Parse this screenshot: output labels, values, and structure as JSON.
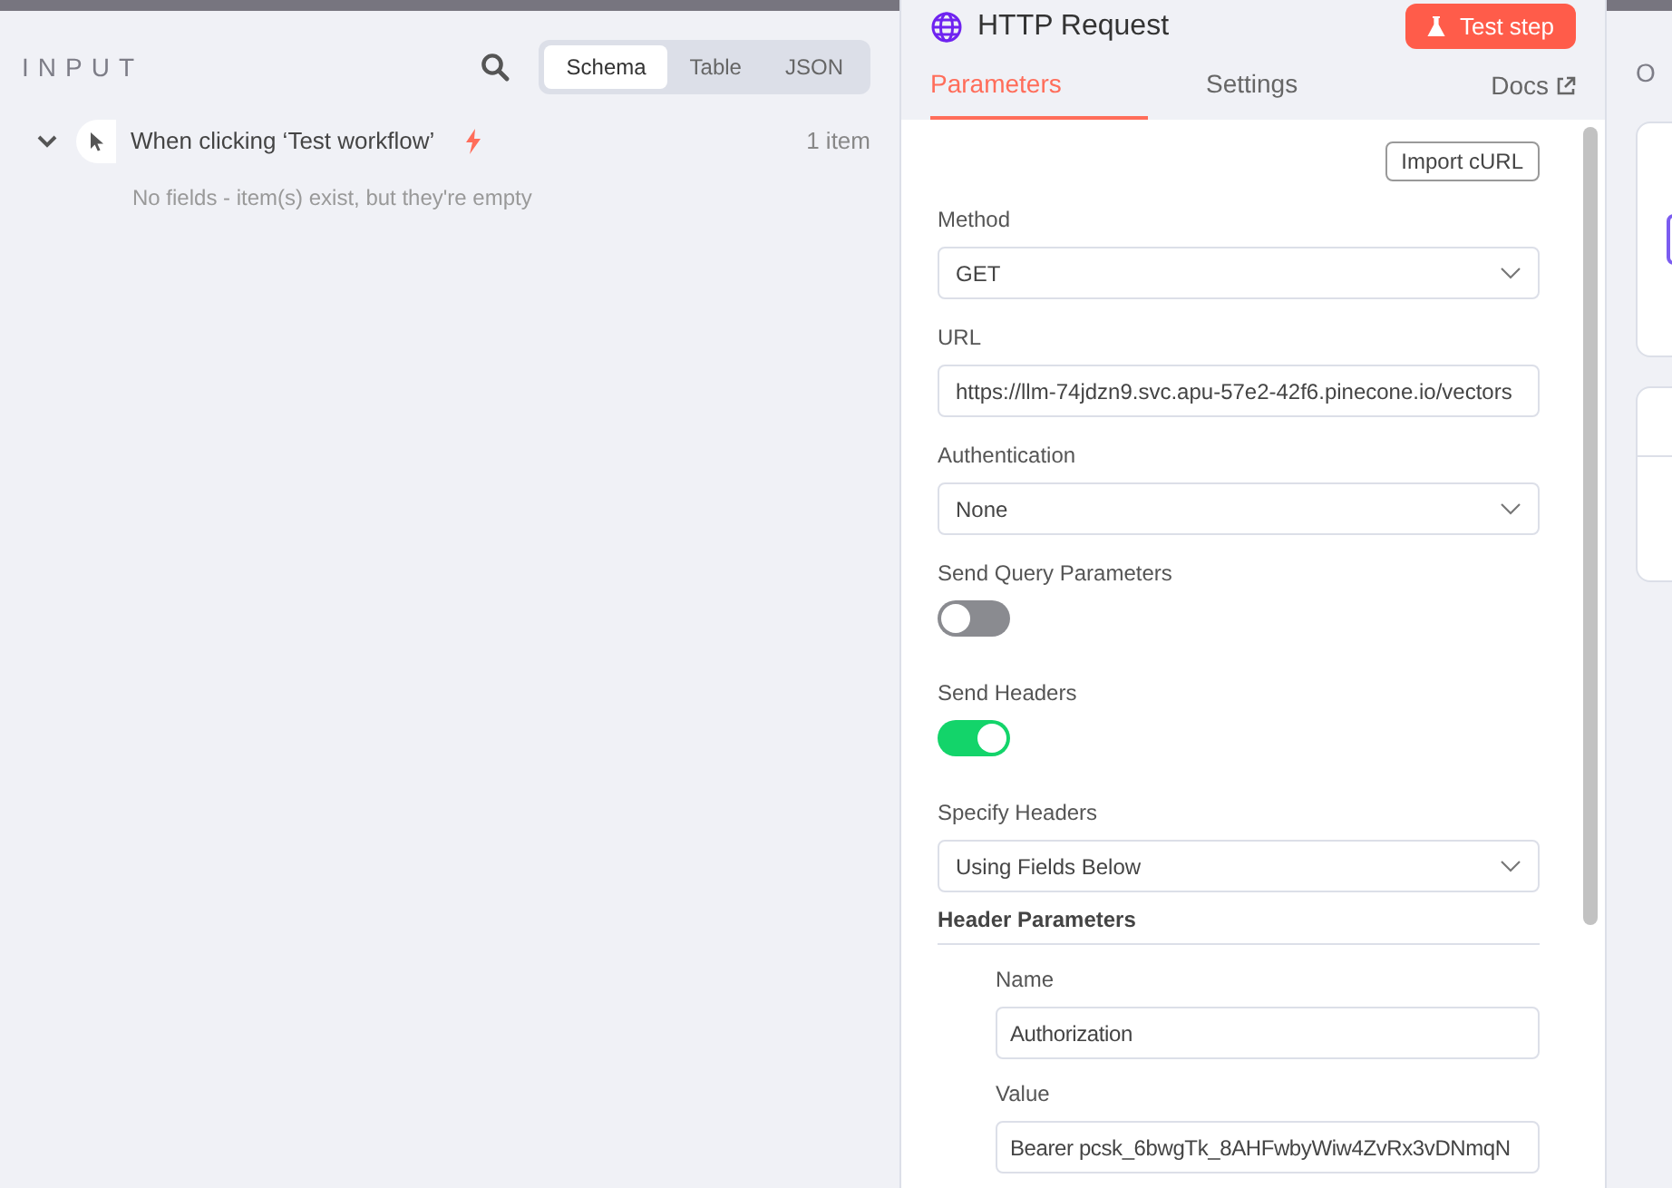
{
  "input_panel": {
    "title": "INPUT",
    "view_tabs": [
      {
        "label": "Schema",
        "selected": true
      },
      {
        "label": "Table",
        "selected": false
      },
      {
        "label": "JSON",
        "selected": false
      }
    ],
    "trigger": {
      "label": "When clicking ‘Test workflow’",
      "count": "1 item",
      "expanded": true,
      "message": "No fields - item(s) exist, but they're empty"
    }
  },
  "node": {
    "title": "HTTP Request",
    "test_button": "Test step",
    "tabs": [
      {
        "label": "Parameters",
        "selected": true
      },
      {
        "label": "Settings",
        "selected": false
      }
    ],
    "docs_link": "Docs",
    "import_button": "Import cURL",
    "fields": [
      {
        "kind": "select",
        "label": "Method",
        "value": "GET"
      },
      {
        "kind": "input",
        "label": "URL",
        "value": "https://llm-74jdzn9.svc.apu-57e2-42f6.pinecone.io/vectors"
      },
      {
        "kind": "select",
        "label": "Authentication",
        "value": "None"
      },
      {
        "kind": "toggle",
        "label": "Send Query Parameters",
        "on": false
      },
      {
        "kind": "toggle",
        "label": "Send Headers",
        "on": true
      },
      {
        "kind": "select",
        "label": "Specify Headers",
        "value": "Using Fields Below"
      }
    ],
    "header_parameters": {
      "title": "Header Parameters",
      "fields": [
        {
          "label": "Name",
          "value": "Authorization"
        },
        {
          "label": "Value",
          "value": "Bearer pcsk_6bwgTk_8AHFwbyWiw4ZvRx3vDNmqN"
        }
      ]
    }
  },
  "output_panel": {
    "title": "O"
  }
}
